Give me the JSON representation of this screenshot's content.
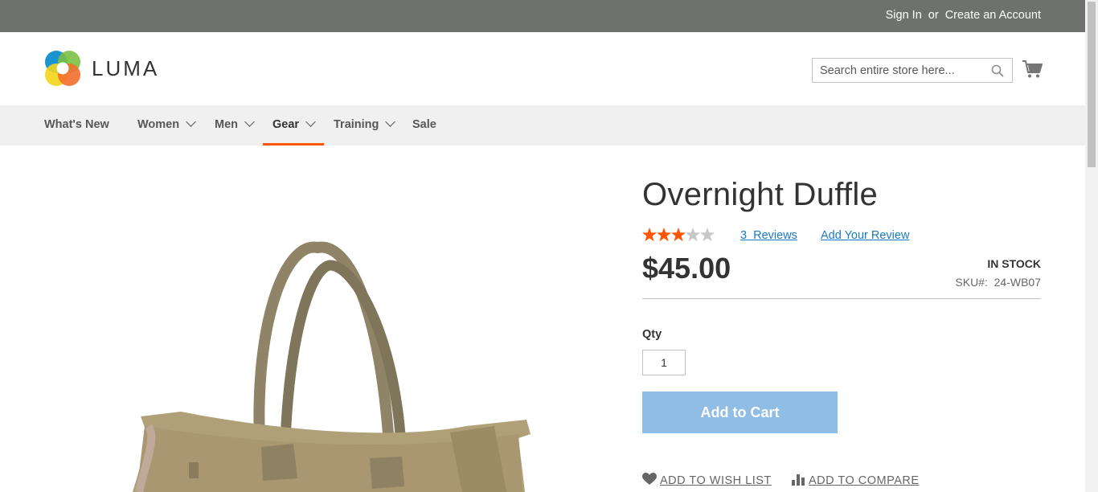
{
  "header": {
    "sign_in": "Sign In",
    "or": "or",
    "create_account": "Create an Account",
    "logo_text": "LUMA",
    "search_placeholder": "Search entire store here...",
    "cart_icon": "cart-icon",
    "search_icon": "search-icon"
  },
  "nav": {
    "items": [
      {
        "label": "What's New",
        "has_dropdown": false
      },
      {
        "label": "Women",
        "has_dropdown": true
      },
      {
        "label": "Men",
        "has_dropdown": true
      },
      {
        "label": "Gear",
        "has_dropdown": true,
        "active": true
      },
      {
        "label": "Training",
        "has_dropdown": true
      },
      {
        "label": "Sale",
        "has_dropdown": false
      }
    ]
  },
  "product": {
    "title": "Overnight Duffle",
    "rating_stars": 3,
    "rating_max": 5,
    "reviews_count": "3",
    "reviews_label": "Reviews",
    "add_review": "Add Your Review",
    "price": "$45.00",
    "stock": "In stock",
    "sku_label": "SKU#:",
    "sku_value": "24-WB07",
    "qty_label": "Qty",
    "qty_value": "1",
    "add_to_cart": "Add to Cart",
    "wish_list": "Add to Wish List",
    "compare": "Add to Compare"
  },
  "colors": {
    "topbar": "#6e716e",
    "accent_orange": "#ff5501",
    "link_blue": "#1979c3",
    "button_blue": "#8fbde6"
  }
}
